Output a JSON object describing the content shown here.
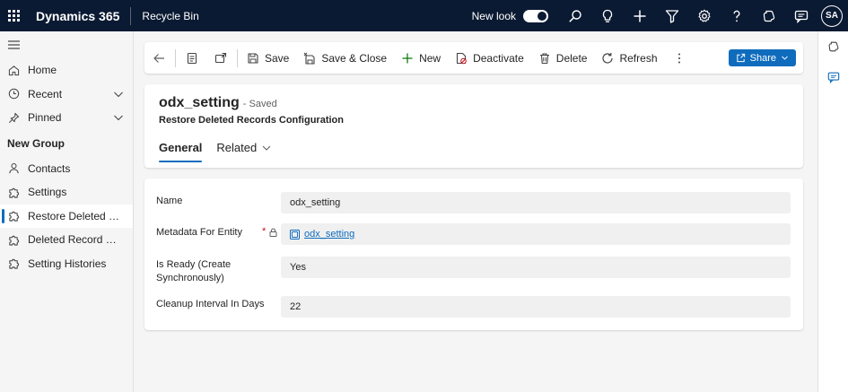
{
  "topbar": {
    "brand": "Dynamics 365",
    "app_name": "Recycle Bin",
    "new_look_label": "New look",
    "new_look_enabled": true,
    "avatar_initials": "SA",
    "icons": [
      "search-icon",
      "lightbulb-icon",
      "plus-icon",
      "filter-icon",
      "gear-icon",
      "help-icon",
      "copilot-icon",
      "chat-icon"
    ]
  },
  "sidebar": {
    "items": [
      {
        "label": "Home",
        "icon": "home-icon"
      },
      {
        "label": "Recent",
        "icon": "clock-icon",
        "expandable": true
      },
      {
        "label": "Pinned",
        "icon": "pin-icon",
        "expandable": true
      }
    ],
    "group_title": "New Group",
    "group_items": [
      {
        "label": "Contacts",
        "icon": "person-icon"
      },
      {
        "label": "Settings",
        "icon": "puzzle-icon"
      },
      {
        "label": "Restore Deleted Rec...",
        "icon": "puzzle-icon",
        "active": true
      },
      {
        "label": "Deleted Record Refe...",
        "icon": "puzzle-icon"
      },
      {
        "label": "Setting Histories",
        "icon": "puzzle-icon"
      }
    ]
  },
  "commandbar": {
    "save": "Save",
    "save_close": "Save & Close",
    "new": "New",
    "deactivate": "Deactivate",
    "delete": "Delete",
    "refresh": "Refresh",
    "share": "Share"
  },
  "record": {
    "title": "odx_setting",
    "status": "- Saved",
    "entity": "Restore Deleted Records Configuration",
    "tabs": [
      {
        "label": "General",
        "active": true
      },
      {
        "label": "Related",
        "dropdown": true
      }
    ]
  },
  "form": {
    "fields": [
      {
        "label": "Name",
        "value": "odx_setting"
      },
      {
        "label": "Metadata For Entity",
        "required_marker": "*",
        "value": "odx_setting",
        "lookup": true,
        "locked": true
      },
      {
        "label": "Is Ready (Create Synchronously)",
        "value": "Yes"
      },
      {
        "label": "Cleanup Interval In Days",
        "value": "22"
      }
    ]
  },
  "colors": {
    "topbar_bg": "#0b1a33",
    "accent": "#0f6cbd",
    "required": "#c50f1f"
  }
}
